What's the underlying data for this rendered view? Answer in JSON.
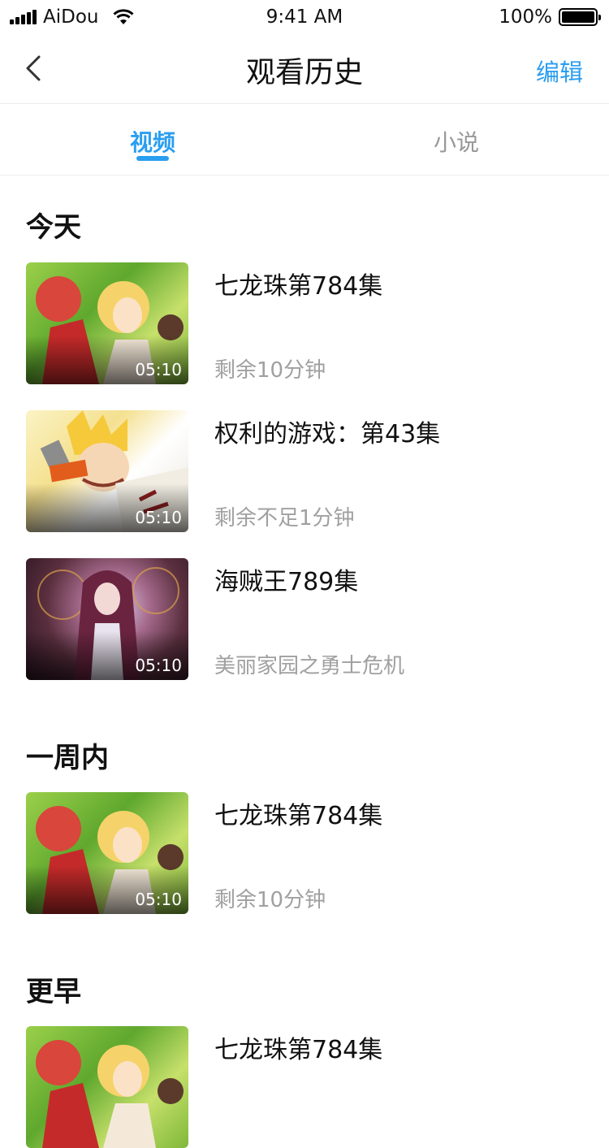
{
  "status": {
    "carrier": "AiDou",
    "time": "9:41 AM",
    "battery": "100%",
    "battery_level": 1.0
  },
  "nav": {
    "title": "观看历史",
    "edit_label": "编辑"
  },
  "tabs": [
    {
      "label": "视频",
      "active": true
    },
    {
      "label": "小说",
      "active": false
    }
  ],
  "sections": [
    {
      "title": "今天",
      "items": [
        {
          "title": "七龙珠第784集",
          "subtitle": "剩余10分钟",
          "duration": "05:10",
          "thumb": "anime-thumbnail-green"
        },
        {
          "title": "权利的游戏：第43集",
          "subtitle": "剩余不足1分钟",
          "duration": "05:10",
          "thumb": "anime-thumbnail-yellow"
        },
        {
          "title": "海贼王789集",
          "subtitle": "美丽家园之勇士危机",
          "duration": "05:10",
          "thumb": "anime-thumbnail-purple"
        }
      ]
    },
    {
      "title": "一周内",
      "items": [
        {
          "title": "七龙珠第784集",
          "subtitle": "剩余10分钟",
          "duration": "05:10",
          "thumb": "anime-thumbnail-green"
        }
      ]
    },
    {
      "title": "更早",
      "items": [
        {
          "title": "七龙珠第784集",
          "subtitle": "",
          "duration": "",
          "thumb": "anime-thumbnail-green"
        }
      ]
    }
  ],
  "colors": {
    "accent": "#2a9ef0",
    "secondary_text": "#a0a0a0"
  }
}
